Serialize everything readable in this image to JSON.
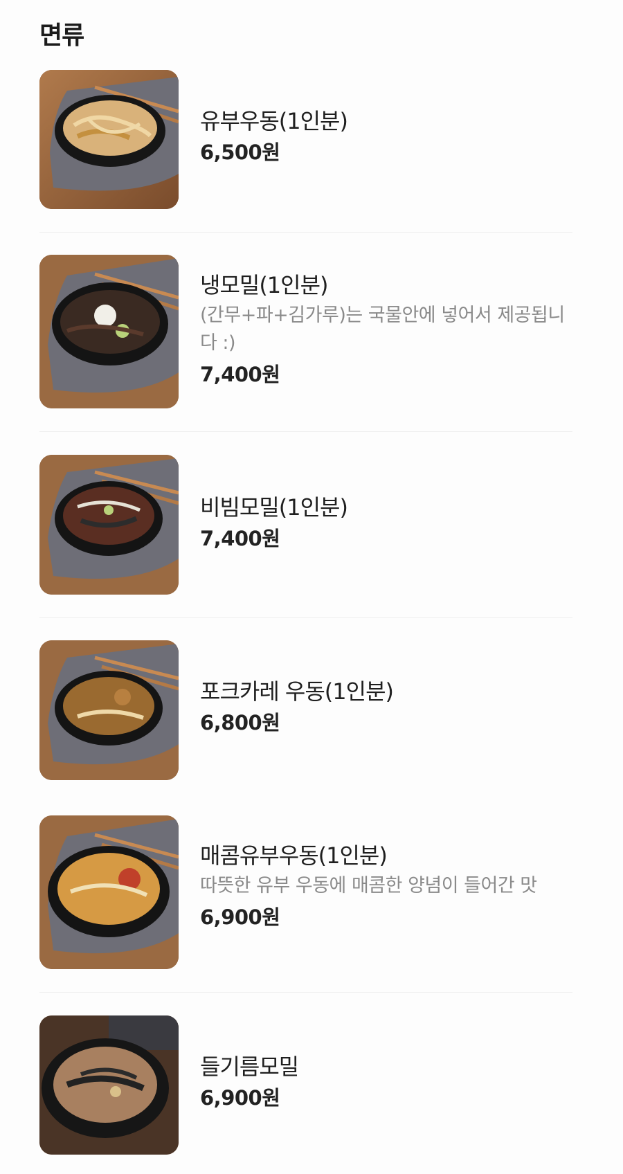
{
  "section": {
    "title": "면류"
  },
  "items": [
    {
      "name": "유부우동(1인분)",
      "desc": "",
      "price": "6,500원",
      "image": "udon-photo"
    },
    {
      "name": "냉모밀(1인분)",
      "desc": "(간무+파+김가루)는 국물안에 넣어서 제공됩니다 :)",
      "price": "7,400원",
      "image": "cold-soba-photo"
    },
    {
      "name": "비빔모밀(1인분)",
      "desc": "",
      "price": "7,400원",
      "image": "bibim-soba-photo"
    },
    {
      "name": "포크카레 우동(1인분)",
      "desc": "",
      "price": "6,800원",
      "image": "curry-udon-photo"
    },
    {
      "name": "매콤유부우동(1인분)",
      "desc": "따뜻한 유부 우동에 매콤한 양념이 들어간 맛",
      "price": "6,900원",
      "image": "spicy-udon-photo"
    },
    {
      "name": "들기름모밀",
      "desc": "",
      "price": "6,900원",
      "image": "perilla-soba-photo"
    }
  ],
  "colors": {
    "wood": "#8a5a36",
    "placemat": "#6f6f78",
    "bowl": "#1a1a1a",
    "divider": "#efefef"
  }
}
